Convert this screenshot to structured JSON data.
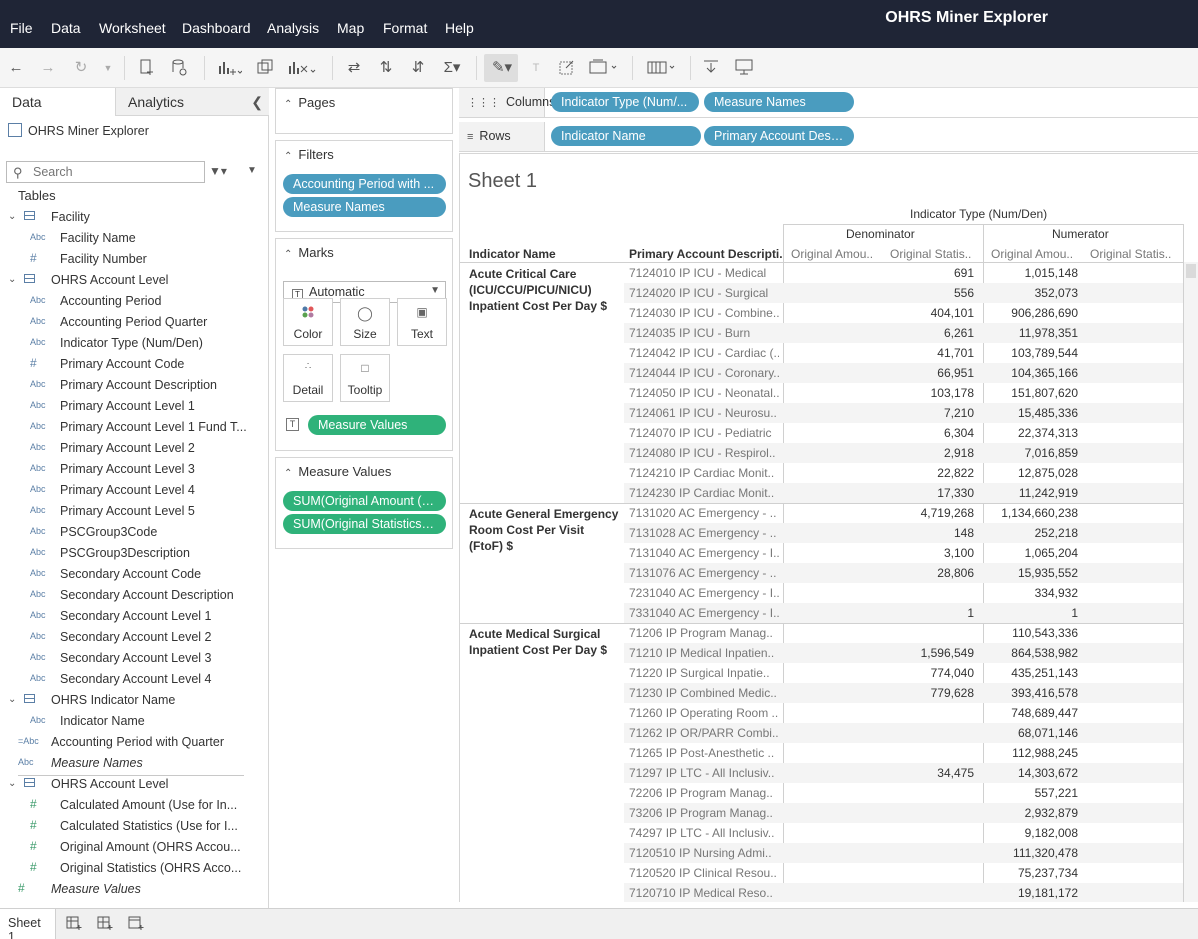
{
  "app": {
    "title": "OHRS Miner Explorer",
    "menus": [
      "File",
      "Data",
      "Worksheet",
      "Dashboard",
      "Analysis",
      "Map",
      "Format",
      "Help"
    ]
  },
  "left_pane": {
    "tab_data": "Data",
    "tab_analytics": "Analytics",
    "datasource": "OHRS Miner Explorer",
    "search_placeholder": "Search",
    "tables_label": "Tables",
    "fields": [
      {
        "kind": "table",
        "icon": "table",
        "label": "Facility"
      },
      {
        "kind": "dim",
        "icon": "Abc",
        "label": "Facility Name"
      },
      {
        "kind": "dim",
        "icon": "#",
        "label": "Facility Number"
      },
      {
        "kind": "table",
        "icon": "table",
        "label": "OHRS Account Level"
      },
      {
        "kind": "dim",
        "icon": "Abc",
        "label": "Accounting Period"
      },
      {
        "kind": "dim",
        "icon": "Abc",
        "label": "Accounting Period Quarter"
      },
      {
        "kind": "dim",
        "icon": "Abc",
        "label": "Indicator Type (Num/Den)"
      },
      {
        "kind": "dim",
        "icon": "#",
        "label": "Primary Account Code"
      },
      {
        "kind": "dim",
        "icon": "Abc",
        "label": "Primary Account Description"
      },
      {
        "kind": "dim",
        "icon": "Abc",
        "label": "Primary Account Level 1"
      },
      {
        "kind": "dim",
        "icon": "Abc",
        "label": "Primary Account Level 1 Fund T..."
      },
      {
        "kind": "dim",
        "icon": "Abc",
        "label": "Primary Account Level 2"
      },
      {
        "kind": "dim",
        "icon": "Abc",
        "label": "Primary Account Level 3"
      },
      {
        "kind": "dim",
        "icon": "Abc",
        "label": "Primary Account Level 4"
      },
      {
        "kind": "dim",
        "icon": "Abc",
        "label": "Primary Account Level 5"
      },
      {
        "kind": "dim",
        "icon": "Abc",
        "label": "PSCGroup3Code"
      },
      {
        "kind": "dim",
        "icon": "Abc",
        "label": "PSCGroup3Description"
      },
      {
        "kind": "dim",
        "icon": "Abc",
        "label": "Secondary Account Code"
      },
      {
        "kind": "dim",
        "icon": "Abc",
        "label": "Secondary Account Description"
      },
      {
        "kind": "dim",
        "icon": "Abc",
        "label": "Secondary Account Level 1"
      },
      {
        "kind": "dim",
        "icon": "Abc",
        "label": "Secondary Account Level 2"
      },
      {
        "kind": "dim",
        "icon": "Abc",
        "label": "Secondary Account Level 3"
      },
      {
        "kind": "dim",
        "icon": "Abc",
        "label": "Secondary Account Level 4"
      },
      {
        "kind": "table",
        "icon": "table",
        "label": "OHRS Indicator Name"
      },
      {
        "kind": "dim",
        "icon": "Abc",
        "label": "Indicator Name"
      },
      {
        "kind": "calc",
        "icon": "=Abc",
        "label": "Accounting Period with Quarter"
      },
      {
        "kind": "calc-italic",
        "icon": "Abc",
        "label": "Measure Names"
      },
      {
        "kind": "table",
        "icon": "table",
        "label": "OHRS Account Level"
      },
      {
        "kind": "measure",
        "icon": "#",
        "label": "Calculated Amount (Use for In..."
      },
      {
        "kind": "measure",
        "icon": "#",
        "label": "Calculated Statistics (Use for I..."
      },
      {
        "kind": "measure",
        "icon": "#",
        "label": "Original Amount (OHRS Accou..."
      },
      {
        "kind": "measure",
        "icon": "#",
        "label": "Original Statistics (OHRS Acco..."
      },
      {
        "kind": "measure-italic",
        "icon": "#",
        "label": "Measure Values"
      }
    ]
  },
  "cards": {
    "pages_title": "Pages",
    "filters_title": "Filters",
    "filters": [
      "Accounting Period with ...",
      "Measure Names"
    ],
    "marks_title": "Marks",
    "mark_type": "Automatic",
    "mark_buttons": [
      "Color",
      "Size",
      "Text",
      "Detail",
      "Tooltip"
    ],
    "marks_pill": "Measure Values",
    "measure_values_title": "Measure Values",
    "measure_values": [
      "SUM(Original Amount (O...",
      "SUM(Original Statistics (..."
    ]
  },
  "shelves": {
    "columns_label": "Columns",
    "columns": [
      "Indicator Type (Num/...",
      "Measure Names"
    ],
    "rows_label": "Rows",
    "rows": [
      "Indicator Name",
      "Primary Account Desc..."
    ]
  },
  "sheet": {
    "title": "Sheet 1",
    "top_header": "Indicator Type (Num/Den)",
    "group_headers": [
      "Denominator",
      "Numerator"
    ],
    "row_headers": [
      "Indicator Name",
      "Primary Account Descripti.."
    ],
    "col_headers": [
      "Original Amou..",
      "Original Statis..",
      "Original Amou..",
      "Original Statis.."
    ],
    "groups": [
      {
        "name": "Acute Critical Care (ICU/CCU/PICU/NICU) Inpatient Cost Per Day $",
        "rows": [
          [
            "7124010 IP ICU - Medical",
            "",
            "691",
            "1,015,148",
            ""
          ],
          [
            "7124020 IP ICU - Surgical",
            "",
            "556",
            "352,073",
            ""
          ],
          [
            "7124030 IP ICU - Combine..",
            "",
            "404,101",
            "906,286,690",
            ""
          ],
          [
            "7124035 IP ICU - Burn",
            "",
            "6,261",
            "11,978,351",
            ""
          ],
          [
            "7124042 IP ICU - Cardiac (..",
            "",
            "41,701",
            "103,789,544",
            ""
          ],
          [
            "7124044 IP ICU - Coronary..",
            "",
            "66,951",
            "104,365,166",
            ""
          ],
          [
            "7124050 IP ICU - Neonatal..",
            "",
            "103,178",
            "151,807,620",
            ""
          ],
          [
            "7124061 IP ICU - Neurosu..",
            "",
            "7,210",
            "15,485,336",
            ""
          ],
          [
            "7124070 IP ICU - Pediatric",
            "",
            "6,304",
            "22,374,313",
            ""
          ],
          [
            "7124080 IP ICU - Respirol..",
            "",
            "2,918",
            "7,016,859",
            ""
          ],
          [
            "7124210 IP Cardiac Monit..",
            "",
            "22,822",
            "12,875,028",
            ""
          ],
          [
            "7124230 IP Cardiac Monit..",
            "",
            "17,330",
            "11,242,919",
            ""
          ]
        ]
      },
      {
        "name": "Acute General Emergency Room Cost Per Visit (FtoF) $",
        "rows": [
          [
            "7131020 AC Emergency - ..",
            "",
            "4,719,268",
            "1,134,660,238",
            ""
          ],
          [
            "7131028 AC Emergency - ..",
            "",
            "148",
            "252,218",
            ""
          ],
          [
            "7131040 AC Emergency - I..",
            "",
            "3,100",
            "1,065,204",
            ""
          ],
          [
            "7131076 AC Emergency - ..",
            "",
            "28,806",
            "15,935,552",
            ""
          ],
          [
            "7231040 AC Emergency - I..",
            "",
            "",
            "334,932",
            ""
          ],
          [
            "7331040 AC Emergency - I..",
            "",
            "1",
            "1",
            ""
          ]
        ]
      },
      {
        "name": "Acute Medical Surgical Inpatient Cost Per Day $",
        "rows": [
          [
            "71206 IP Program Manag..",
            "",
            "",
            "110,543,336",
            ""
          ],
          [
            "71210 IP Medical Inpatien..",
            "",
            "1,596,549",
            "864,538,982",
            ""
          ],
          [
            "71220 IP Surgical Inpatie..",
            "",
            "774,040",
            "435,251,143",
            ""
          ],
          [
            "71230 IP Combined Medic..",
            "",
            "779,628",
            "393,416,578",
            ""
          ],
          [
            "71260 IP Operating Room ..",
            "",
            "",
            "748,689,447",
            ""
          ],
          [
            "71262 IP OR/PARR Combi..",
            "",
            "",
            "68,071,146",
            ""
          ],
          [
            "71265 IP Post-Anesthetic ..",
            "",
            "",
            "112,988,245",
            ""
          ],
          [
            "71297 IP LTC - All Inclusiv..",
            "",
            "34,475",
            "14,303,672",
            ""
          ],
          [
            "72206 IP Program Manag..",
            "",
            "",
            "557,221",
            ""
          ],
          [
            "73206 IP Program Manag..",
            "",
            "",
            "2,932,879",
            ""
          ],
          [
            "74297 IP LTC - All Inclusiv..",
            "",
            "",
            "9,182,008",
            ""
          ],
          [
            "7120510 IP Nursing Admi..",
            "",
            "",
            "111,320,478",
            ""
          ],
          [
            "7120520 IP Clinical Resou..",
            "",
            "",
            "75,237,734",
            ""
          ],
          [
            "7120710 IP Medical Reso..",
            "",
            "",
            "19,181,172",
            ""
          ]
        ]
      }
    ]
  },
  "bottom": {
    "sheet_tab": "Sheet 1"
  }
}
